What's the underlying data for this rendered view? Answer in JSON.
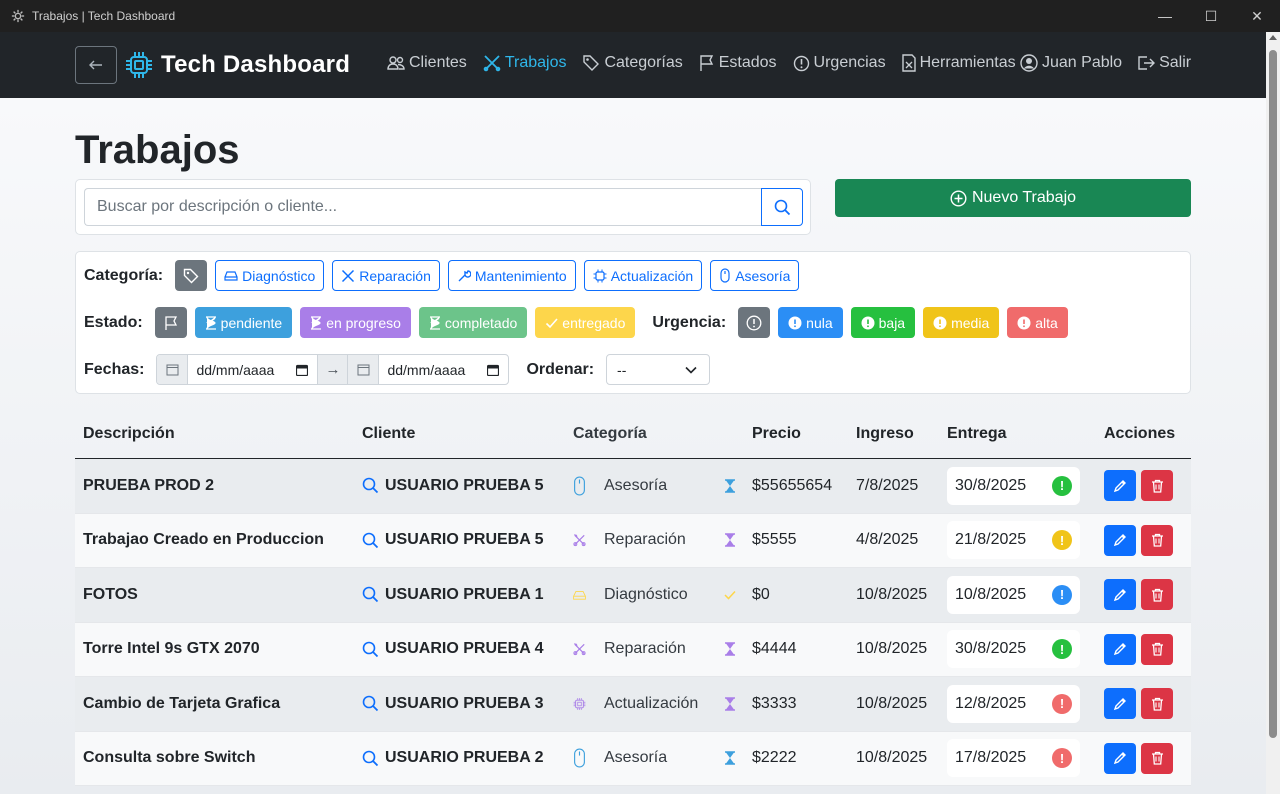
{
  "window": {
    "title": "Trabajos | Tech Dashboard",
    "controls": [
      "—",
      "☐",
      "✕"
    ]
  },
  "navbar": {
    "brand": "Tech Dashboard",
    "items": [
      {
        "label": "Clientes",
        "icon": "people-icon"
      },
      {
        "label": "Trabajos",
        "icon": "tools-icon",
        "active": true
      },
      {
        "label": "Categorías",
        "icon": "tags-icon"
      },
      {
        "label": "Estados",
        "icon": "flag-icon"
      },
      {
        "label": "Urgencias",
        "icon": "exclamation-icon"
      },
      {
        "label": "Herramientas",
        "icon": "file-x-icon"
      }
    ],
    "user": "Juan Pablo",
    "logout": "Salir"
  },
  "page": {
    "title": "Trabajos"
  },
  "search": {
    "placeholder": "Buscar por descripción o cliente..."
  },
  "new_button": "Nuevo Trabajo",
  "filters": {
    "category_label": "Categoría:",
    "categories": [
      "Diagnóstico",
      "Reparación",
      "Mantenimiento",
      "Actualización",
      "Asesoría"
    ],
    "state_label": "Estado:",
    "states": [
      {
        "label": "pendiente",
        "color": "#3da0dd"
      },
      {
        "label": "en progreso",
        "color": "#a97ee8"
      },
      {
        "label": "completado",
        "color": "#6cc48a"
      },
      {
        "label": "entregado",
        "color": "#fdd64b"
      }
    ],
    "urgency_label": "Urgencia:",
    "urgencies": [
      {
        "label": "nula",
        "color": "#2b8ef5"
      },
      {
        "label": "baja",
        "color": "#26c03f"
      },
      {
        "label": "media",
        "color": "#f0c419"
      },
      {
        "label": "alta",
        "color": "#f06b6b"
      }
    ],
    "dates_label": "Fechas:",
    "date_from": "dd/mm/aaaa",
    "date_to": "dd/mm/aaaa",
    "sort_label": "Ordenar:",
    "sort_value": "--"
  },
  "table": {
    "headers": [
      "Descripción",
      "Cliente",
      "Categoría",
      "Precio",
      "Ingreso",
      "Entrega",
      "Acciones"
    ],
    "rows": [
      {
        "desc": "PRUEBA PROD 2",
        "client": "USUARIO PRUEBA 5",
        "category": "Asesoría",
        "cat_icon": "mouse-icon",
        "state_icon": "hourglass-icon",
        "state_color": "#3da0dd",
        "price": "$55655654",
        "in": "7/8/2025",
        "out": "30/8/2025",
        "urg_color": "#26c03f"
      },
      {
        "desc": "Trabajao Creado en Produccion",
        "client": "USUARIO PRUEBA 5",
        "category": "Reparación",
        "cat_icon": "tools-icon",
        "state_icon": "hourglass-icon",
        "state_color": "#a97ee8",
        "price": "$5555",
        "in": "4/8/2025",
        "out": "21/8/2025",
        "urg_color": "#f0c419"
      },
      {
        "desc": "FOTOS",
        "client": "USUARIO PRUEBA 1",
        "category": "Diagnóstico",
        "cat_icon": "drive-icon",
        "state_icon": "check-icon",
        "state_color": "#fdd64b",
        "price": "$0",
        "in": "10/8/2025",
        "out": "10/8/2025",
        "urg_color": "#2b8ef5"
      },
      {
        "desc": "Torre Intel 9s GTX 2070",
        "client": "USUARIO PRUEBA 4",
        "category": "Reparación",
        "cat_icon": "tools-icon",
        "state_icon": "hourglass-icon",
        "state_color": "#a97ee8",
        "price": "$4444",
        "in": "10/8/2025",
        "out": "30/8/2025",
        "urg_color": "#26c03f"
      },
      {
        "desc": "Cambio de Tarjeta Grafica",
        "client": "USUARIO PRUEBA 3",
        "category": "Actualización",
        "cat_icon": "cpu-icon",
        "state_icon": "hourglass-icon",
        "state_color": "#a97ee8",
        "price": "$3333",
        "in": "10/8/2025",
        "out": "12/8/2025",
        "urg_color": "#f06b6b"
      },
      {
        "desc": "Consulta sobre Switch",
        "client": "USUARIO PRUEBA 2",
        "category": "Asesoría",
        "cat_icon": "mouse-icon",
        "state_icon": "hourglass-icon",
        "state_color": "#3da0dd",
        "price": "$2222",
        "in": "10/8/2025",
        "out": "17/8/2025",
        "urg_color": "#f06b6b"
      }
    ]
  }
}
